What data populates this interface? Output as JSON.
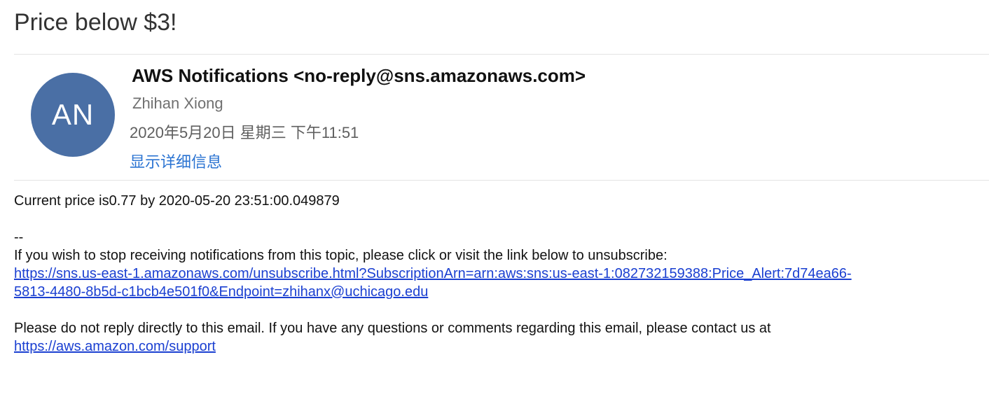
{
  "email": {
    "subject": "Price below $3!",
    "avatar_initials": "AN",
    "avatar_color": "#4a6fa5",
    "sender": "AWS Notifications <no-reply@sns.amazonaws.com>",
    "recipient": "Zhihan Xiong",
    "datetime": "2020年5月20日 星期三 下午11:51",
    "show_details": "显示详细信息",
    "body": {
      "current_price": "Current price is0.77 by 2020-05-20 23:51:00.049879",
      "separator": "--",
      "unsubscribe_intro": "If you wish to stop receiving notifications from this topic, please click or visit the link below to unsubscribe:",
      "unsubscribe_link_line1": "https://sns.us-east-1.amazonaws.com/unsubscribe.html?SubscriptionArn=arn:aws:sns:us-east-1:082732159388:Price_Alert:7d74ea66-",
      "unsubscribe_link_line2": "5813-4480-8b5d-c1bcb4e501f0&Endpoint=zhihanx@uchicago.edu",
      "no_reply_notice": "Please do not reply directly to this email. If you have any questions or comments regarding this email, please contact us at",
      "support_link": "https://aws.amazon.com/support"
    }
  }
}
